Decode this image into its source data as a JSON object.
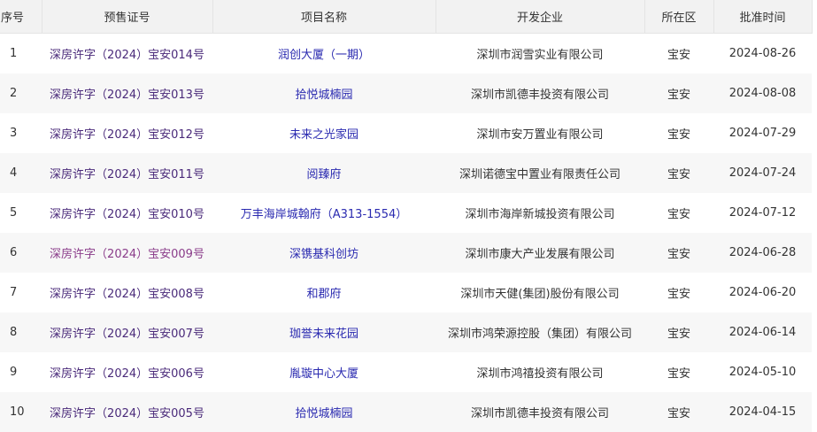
{
  "table": {
    "headers": [
      "序号",
      "预售证号",
      "项目名称",
      "开发企业",
      "所在区",
      "批准时间"
    ],
    "rows": [
      {
        "no": "1",
        "license": "深房许字（2024）宝安014号",
        "project": "润创大厦（一期）",
        "developer": "深圳市润雪实业有限公司",
        "district": "宝安",
        "date": "2024-08-26"
      },
      {
        "no": "2",
        "license": "深房许字（2024）宝安013号",
        "project": "拾悦城楠园",
        "developer": "深圳市凯德丰投资有限公司",
        "district": "宝安",
        "date": "2024-08-08"
      },
      {
        "no": "3",
        "license": "深房许字（2024）宝安012号",
        "project": "未来之光家园",
        "developer": "深圳市安万置业有限公司",
        "district": "宝安",
        "date": "2024-07-29"
      },
      {
        "no": "4",
        "license": "深房许字（2024）宝安011号",
        "project": "阅臻府",
        "developer": "深圳诺德宝中置业有限责任公司",
        "district": "宝安",
        "date": "2024-07-24"
      },
      {
        "no": "5",
        "license": "深房许字（2024）宝安010号",
        "project": "万丰海岸城翰府（A313-1554）",
        "developer": "深圳市海岸新城投资有限公司",
        "district": "宝安",
        "date": "2024-07-12"
      },
      {
        "no": "6",
        "license": "深房许字（2024）宝安009号",
        "project": "深镌基科创坊",
        "developer": "深圳市康大产业发展有限公司",
        "district": "宝安",
        "date": "2024-06-28"
      },
      {
        "no": "7",
        "license": "深房许字（2024）宝安008号",
        "project": "和郡府",
        "developer": "深圳市天健(集团)股份有限公司",
        "district": "宝安",
        "date": "2024-06-20"
      },
      {
        "no": "8",
        "license": "深房许字（2024）宝安007号",
        "project": "珈誉未来花园",
        "developer": "深圳市鸿荣源控股（集团）有限公司",
        "district": "宝安",
        "date": "2024-06-14"
      },
      {
        "no": "9",
        "license": "深房许字（2024）宝安006号",
        "project": "胤璇中心大厦",
        "developer": "深圳市鸿禧投资有限公司",
        "district": "宝安",
        "date": "2024-05-10"
      },
      {
        "no": "10",
        "license": "深房许字（2024）宝安005号",
        "project": "拾悦城楠园",
        "developer": "深圳市凯德丰投资有限公司",
        "district": "宝安",
        "date": "2024-04-15"
      }
    ]
  }
}
